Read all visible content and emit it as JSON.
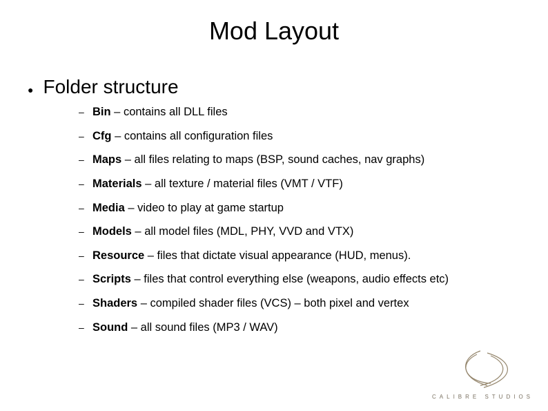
{
  "title": "Mod Layout",
  "heading": "Folder structure",
  "items": [
    {
      "name": "Bin",
      "desc": " – contains all DLL files"
    },
    {
      "name": "Cfg",
      "desc": " – contains all configuration files"
    },
    {
      "name": "Maps",
      "desc": " – all files relating to maps (BSP, sound caches, nav graphs)"
    },
    {
      "name": "Materials",
      "desc": " – all texture / material files (VMT / VTF)"
    },
    {
      "name": "Media",
      "desc": " – video to play at game startup"
    },
    {
      "name": "Models",
      "desc": " – all model files (MDL, PHY, VVD and VTX)"
    },
    {
      "name": "Resource",
      "desc": " – files that dictate visual appearance (HUD, menus)."
    },
    {
      "name": "Scripts",
      "desc": " – files that control everything else (weapons, audio effects etc)"
    },
    {
      "name": "Shaders",
      "desc": " – compiled shader files (VCS) – both pixel and vertex"
    },
    {
      "name": "Sound",
      "desc": " – all sound files (MP3 / WAV)"
    }
  ],
  "logo_text": "CALIBRE STUDIOS"
}
